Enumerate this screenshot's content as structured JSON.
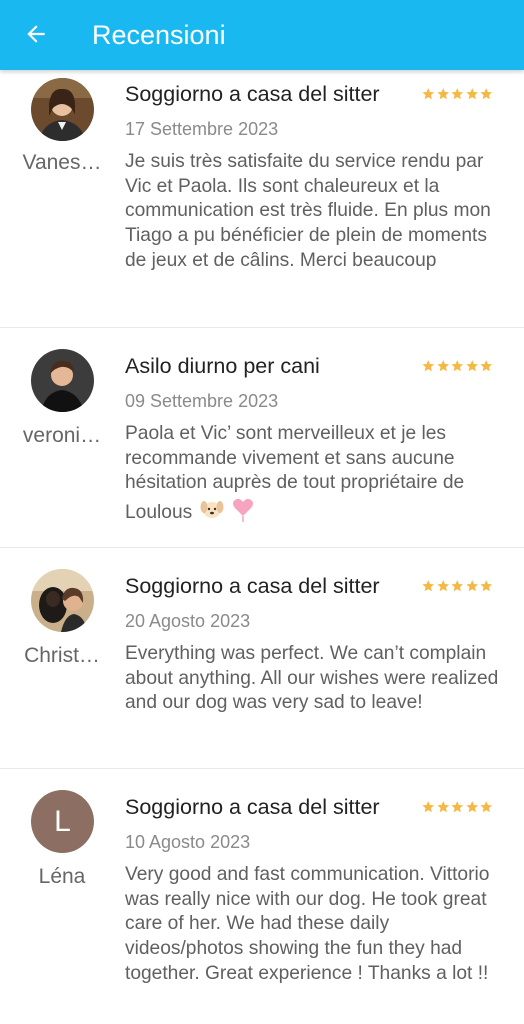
{
  "header": {
    "title": "Recensioni",
    "back_icon": "arrow-left-icon",
    "background": "#1ab8f0"
  },
  "star_color": "#f5b942",
  "reviews": [
    {
      "reviewer": "Vanes…",
      "service": "Soggiorno a casa del sitter",
      "rating": 5,
      "date": "17 Settembre 2023",
      "text": "Je suis très satisfaite du service rendu par Vic et Paola. Ils sont chaleureux et la communication est très fluide. En plus mon Tiago a pu bénéficier de plein de moments de jeux et de câlins. Merci beaucoup"
    },
    {
      "reviewer": "veroni…",
      "service": "Asilo diurno per cani",
      "rating": 5,
      "date": "09 Settembre 2023",
      "text": "Paola et Vic’ sont merveilleux et je les recommande vivement et sans aucune hésitation auprès de tout propriétaire de Loulous",
      "emojis": [
        "dog-face-icon",
        "pink-heart-icon"
      ]
    },
    {
      "reviewer": "Christ…",
      "service": "Soggiorno a casa del sitter",
      "rating": 5,
      "date": "20 Agosto 2023",
      "text": "Everything was perfect. We can’t complain about anything. All our wishes were realized and our dog was very sad to leave!"
    },
    {
      "reviewer": "Léna",
      "avatar_letter": "L",
      "service": "Soggiorno a casa del sitter",
      "rating": 5,
      "date": "10 Agosto 2023",
      "text": "Very good and fast communication. Vittorio was really nice with our dog. He took great care of her. We had these daily videos/photos showing the fun they had together. Great experience ! Thanks a lot !!"
    }
  ]
}
